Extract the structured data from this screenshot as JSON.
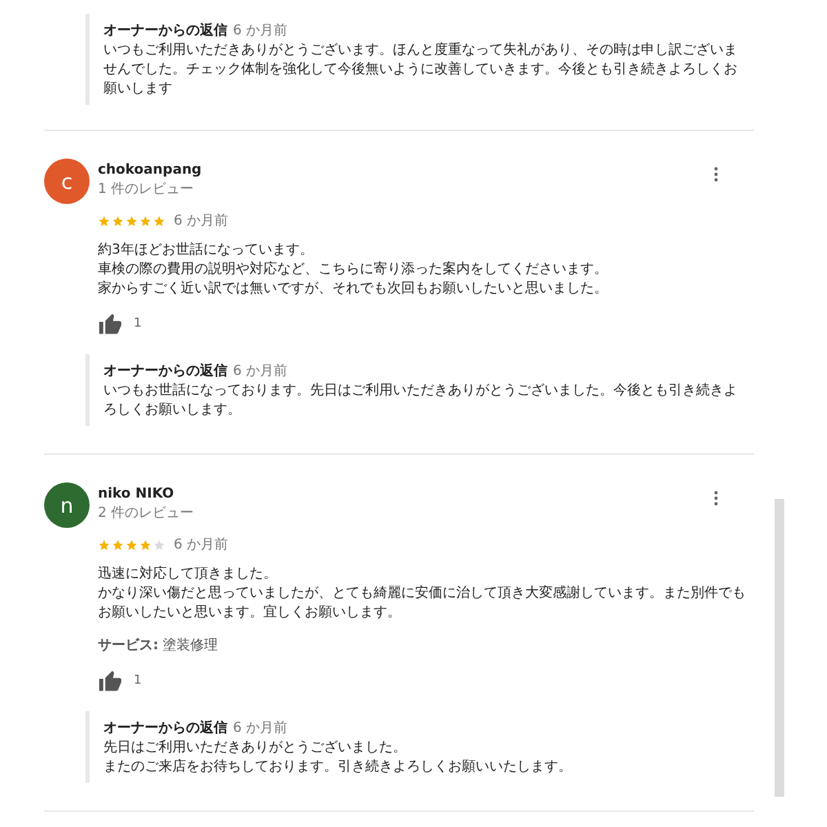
{
  "top_reply": {
    "label": "オーナーからの返信",
    "time": "6 か月前",
    "text": "いつもご利用いただきありがとうございます。ほんと度重なって失礼があり、その時は申し訳ございませんでした。チェック体制を強化して今後無いように改善していきます。今後とも引き続きよろしくお願いします"
  },
  "reviews": [
    {
      "initial": "c",
      "color": "#e0592a",
      "name": "chokoanpang",
      "count": "1 件のレビュー",
      "stars": 5,
      "time": "6 か月前",
      "text": [
        "約3年ほどお世話になっています。",
        "車検の際の費用の説明や対応など、こちらに寄り添った案内をしてくださいます。",
        "家からすごく近い訳では無いですが、それでも次回もお願いしたいと思いました。"
      ],
      "likes": "1",
      "reply": {
        "label": "オーナーからの返信",
        "time": "6 か月前",
        "text": "いつもお世話になっております。先日はご利用いただきありがとうございました。今後とも引き続きよろしくお願いします。"
      }
    },
    {
      "initial": "n",
      "color": "#2e6b30",
      "name": "niko NIKO",
      "count": "2 件のレビュー",
      "stars": 4,
      "time": "6 か月前",
      "text": [
        "迅速に対応して頂きました。",
        "かなり深い傷だと思っていましたが、とても綺麗に安価に治して頂き大変感謝しています。また別件でもお願いしたいと思います。宜しくお願いします。"
      ],
      "service_label": "サービス:",
      "service": "塗装修理",
      "likes": "1",
      "reply": {
        "label": "オーナーからの返信",
        "time": "6 か月前",
        "text": [
          "先日はご利用いただきありがとうございました。",
          "またのご来店をお待ちしております。引き続きよろしくお願いいたします。"
        ]
      }
    }
  ]
}
